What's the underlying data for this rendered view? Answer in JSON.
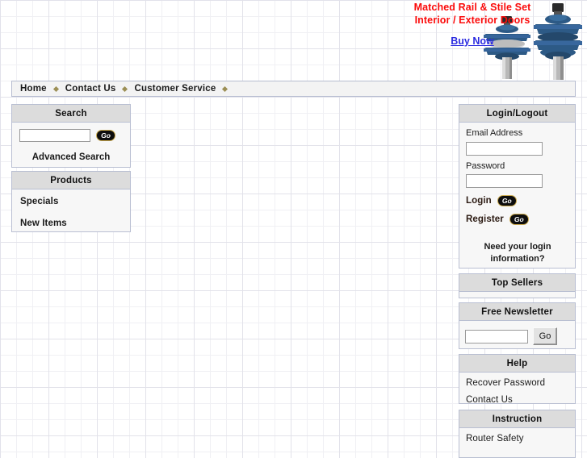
{
  "banner": {
    "headline_line1": "Matched Rail & Stile Set",
    "headline_line2": "Interior / Exterior Doors",
    "cta": "Buy Now",
    "headline_color": "#fb0b0b",
    "cta_color": "#2a2ae0",
    "bit_color": "#2d5a86"
  },
  "nav": {
    "items": [
      {
        "label": "Home"
      },
      {
        "label": "Contact Us"
      },
      {
        "label": "Customer Service"
      }
    ],
    "separator_color": "#9c8f55"
  },
  "search": {
    "title": "Search",
    "input_value": "",
    "input_placeholder": "",
    "go_label": "Go",
    "advanced_label": "Advanced Search"
  },
  "products": {
    "title": "Products",
    "items": [
      {
        "label": "Specials"
      },
      {
        "label": "New Items"
      }
    ]
  },
  "login": {
    "title": "Login/Logout",
    "email_label": "Email Address",
    "email_value": "",
    "password_label": "Password",
    "password_value": "",
    "login_label": "Login",
    "login_go": "Go",
    "register_label": "Register",
    "register_go": "Go",
    "need_help": "Need your login information?"
  },
  "top_sellers": {
    "title": "Top Sellers"
  },
  "newsletter": {
    "title": "Free Newsletter",
    "input_value": "",
    "input_placeholder": "",
    "go_label": "Go"
  },
  "help": {
    "title": "Help",
    "items": [
      {
        "label": "Recover Password"
      },
      {
        "label": "Contact Us"
      }
    ]
  },
  "instruction": {
    "title": "Instruction",
    "items": [
      {
        "label": "Router Safety"
      }
    ]
  }
}
